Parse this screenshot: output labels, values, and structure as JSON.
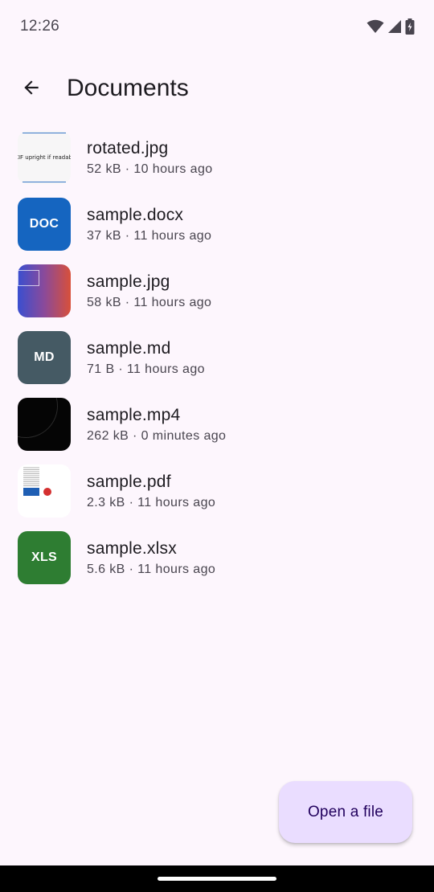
{
  "status_bar": {
    "time": "12:26",
    "icons": [
      "wifi-icon",
      "cellular-signal-icon",
      "battery-charging-icon"
    ]
  },
  "app_bar": {
    "back_icon": "arrow-back-icon",
    "title": "Documents"
  },
  "files": [
    {
      "name": "rotated.jpg",
      "meta": "52 kB · 10 hours ago",
      "thumb": "image-preview",
      "thumb_text": "EXIF upright if readable"
    },
    {
      "name": "sample.docx",
      "meta": "37 kB · 11 hours ago",
      "thumb": "badge",
      "thumb_text": "DOC",
      "color": "#1565c0"
    },
    {
      "name": "sample.jpg",
      "meta": "58 kB · 11 hours ago",
      "thumb": "image-preview",
      "thumb_text": ""
    },
    {
      "name": "sample.md",
      "meta": "71 B · 11 hours ago",
      "thumb": "badge",
      "thumb_text": "MD",
      "color": "#455a64"
    },
    {
      "name": "sample.mp4",
      "meta": "262 kB · 0 minutes ago",
      "thumb": "video-preview",
      "thumb_text": ""
    },
    {
      "name": "sample.pdf",
      "meta": "2.3 kB · 11 hours ago",
      "thumb": "pdf-preview",
      "thumb_text": ""
    },
    {
      "name": "sample.xlsx",
      "meta": "5.6 kB · 11 hours ago",
      "thumb": "badge",
      "thumb_text": "XLS",
      "color": "#2e7d32"
    }
  ],
  "fab": {
    "label": "Open a file"
  },
  "colors": {
    "background": "#fdf6fd",
    "fab_background": "#eaddff",
    "fab_text": "#21005d"
  }
}
